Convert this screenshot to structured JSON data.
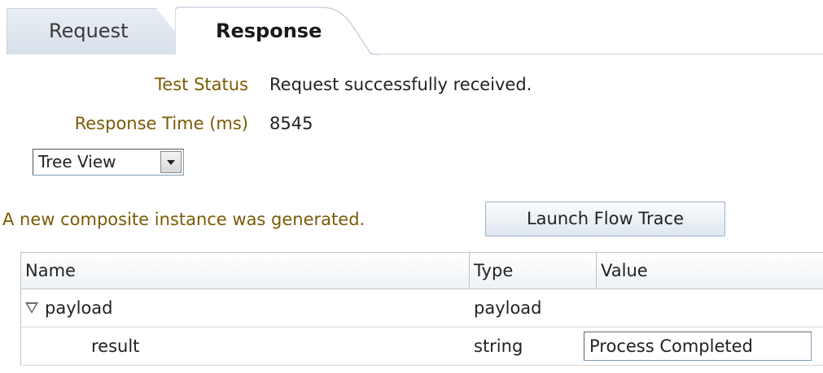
{
  "tabs": {
    "request_label": "Request",
    "response_label": "Response"
  },
  "status": {
    "test_status_label": "Test Status",
    "test_status_value": "Request successfully received.",
    "response_time_label": "Response Time (ms)",
    "response_time_value": "8545"
  },
  "view_select": {
    "value": "Tree View"
  },
  "composite": {
    "message": "A new composite instance was generated.",
    "button_label": "Launch Flow Trace"
  },
  "table": {
    "headers": {
      "name": "Name",
      "type": "Type",
      "value": "Value"
    },
    "rows": [
      {
        "name": "payload",
        "type": "payload",
        "value": ""
      },
      {
        "name": "result",
        "type": "string",
        "value": "Process Completed"
      }
    ]
  }
}
